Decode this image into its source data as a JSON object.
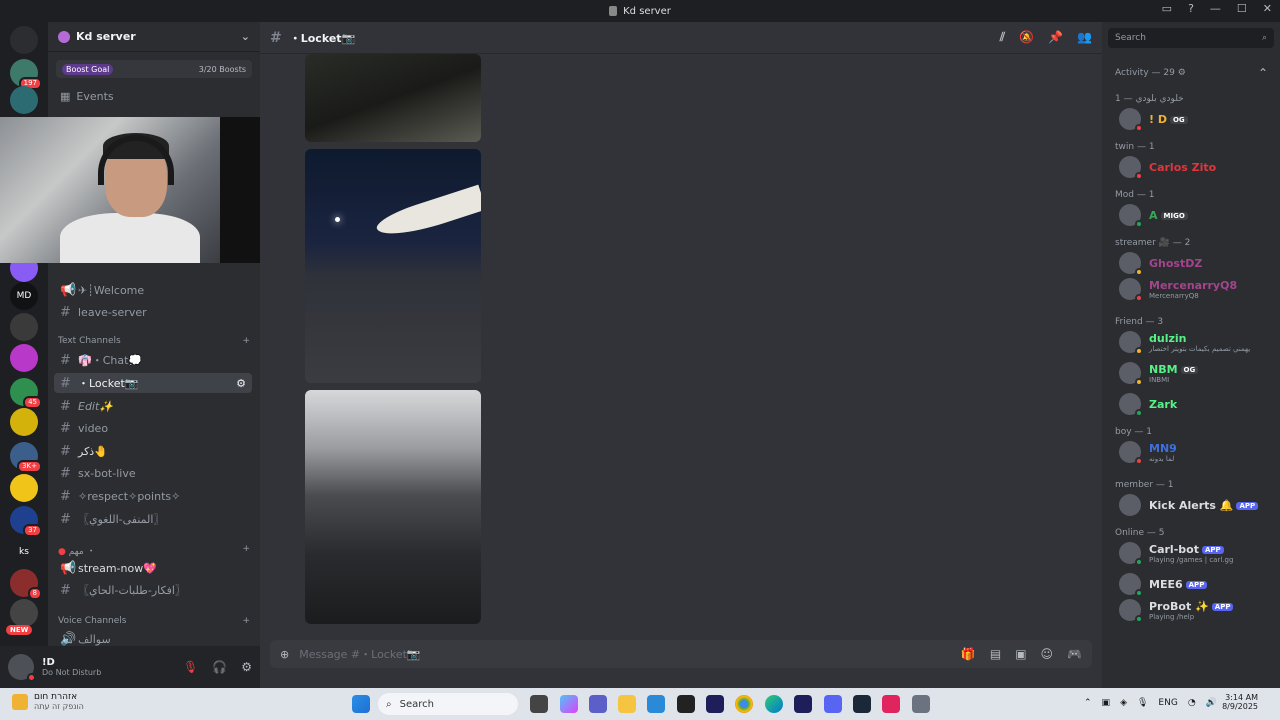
{
  "window": {
    "title": "Kd server"
  },
  "guilds": [
    {
      "label": "",
      "badge": "",
      "color": "#2b2d31"
    },
    {
      "label": "",
      "badge": "197",
      "color": "#3d7a6a"
    },
    {
      "label": "",
      "badge": "",
      "color": "#2d6b73"
    },
    {
      "label": "",
      "badge": "",
      "color": "#8a5cf6"
    },
    {
      "label": "MD",
      "badge": "",
      "color": "#111214"
    },
    {
      "label": "",
      "badge": "",
      "color": "#3a3a3a"
    },
    {
      "label": "",
      "badge": "",
      "color": "#b838c9"
    },
    {
      "label": "",
      "badge": "45",
      "color": "#2f8f4e"
    },
    {
      "label": "",
      "badge": "",
      "color": "#d4b20c"
    },
    {
      "label": "",
      "badge": "3K+",
      "color": "#3b5f8a"
    },
    {
      "label": "",
      "badge": "",
      "color": "#f0c419"
    },
    {
      "label": "",
      "badge": "37",
      "color": "#1f3f8f"
    },
    {
      "label": "ks",
      "badge": "",
      "color": "#1e1f22"
    },
    {
      "label": "",
      "badge": "8",
      "color": "#8c2d2d"
    },
    {
      "label": "",
      "badge": "",
      "color": "#444"
    }
  ],
  "new_badge": "NEW",
  "server": {
    "name": "Kd server",
    "boost_label": "Boost Goal",
    "boost_count": "3/20 Boosts",
    "events_label": "Events"
  },
  "channels": {
    "voice_top": [
      {
        "name": "✈┊Welcome",
        "icon": "📢"
      },
      {
        "name": "leave-server",
        "icon": "#"
      }
    ],
    "text_category": "Text Channels",
    "text": [
      {
        "name": "👘・Chat💭",
        "icon": "#"
      },
      {
        "name": "・Locket📷",
        "icon": "#"
      },
      {
        "name": "Edit✨",
        "icon": "#"
      },
      {
        "name": "video",
        "icon": "#"
      },
      {
        "name": "ذكر🤚",
        "icon": "#"
      },
      {
        "name": "sx-bot-live",
        "icon": "#"
      },
      {
        "name": "✧respect✧points✧",
        "icon": "#"
      },
      {
        "name": "〖المنفى-اللغوي〗",
        "icon": "#"
      }
    ],
    "important_category": "مهم ・",
    "important": [
      {
        "name": "stream-now💖",
        "icon": "📢"
      },
      {
        "name": "〖افكار-طلبات-الحاي〗",
        "icon": "#"
      }
    ],
    "voice_category": "Voice Channels",
    "voice": [
      {
        "name": "سوالف",
        "icon": "🔊"
      }
    ]
  },
  "user": {
    "name": "!D",
    "status": "Do Not Disturb"
  },
  "channel_header": {
    "name": "・Locket📷"
  },
  "composer": {
    "placeholder": "Message #・Locket📷"
  },
  "members": {
    "search_placeholder": "Search",
    "activity_header": "Activity — 29",
    "groups": [
      {
        "title": "خلودي بلودي — 1",
        "members": [
          {
            "name": "! D",
            "tag": "OG",
            "color": "#f0b232",
            "sub": "",
            "status": "#f23f43"
          }
        ]
      },
      {
        "title": "twin — 1",
        "members": [
          {
            "name": "Carlos Zito",
            "tag": "",
            "color": "#e0363c",
            "sub": "",
            "status": "#f23f43"
          }
        ]
      },
      {
        "title": "Mod — 1",
        "members": [
          {
            "name": "A",
            "tag": "MIGO",
            "color": "#3ba55c",
            "sub": "",
            "status": "#23a559"
          }
        ]
      },
      {
        "title": "streamer 🎥 — 2",
        "members": [
          {
            "name": "GhostDZ",
            "tag": "",
            "color": "#a3458c",
            "sub": "",
            "status": "#f0b232"
          },
          {
            "name": "MercenarryQ8",
            "tag": "",
            "color": "#a3458c",
            "sub": "MercenarryQ8",
            "status": "#f23f43"
          }
        ]
      },
      {
        "title": "Friend — 3",
        "members": [
          {
            "name": "dulzin",
            "tag": "",
            "color": "#57f287",
            "sub": "يهمني تصميم بكيمات بتويتر اختصار",
            "status": "#f0b232"
          },
          {
            "name": "NBM",
            "tag": "OG",
            "color": "#57f287",
            "sub": "INBMI",
            "status": "#f0b232"
          },
          {
            "name": "Zark",
            "tag": "",
            "color": "#57f287",
            "sub": "",
            "status": "#23a559"
          }
        ]
      },
      {
        "title": "boy — 1",
        "members": [
          {
            "name": "MN9",
            "tag": "",
            "color": "#3e70dd",
            "sub": "لما بدونه",
            "status": "#f23f43"
          }
        ]
      },
      {
        "title": "member — 1",
        "members": [
          {
            "name": "Kick Alerts 🔔",
            "tag": "APP",
            "color": "#dbdee1",
            "sub": "",
            "status": ""
          }
        ]
      },
      {
        "title": "Online — 5",
        "members": [
          {
            "name": "Carl-bot",
            "tag": "APP",
            "color": "#dbdee1",
            "sub": "Playing /games | carl.gg",
            "status": "#23a559"
          },
          {
            "name": "MEE6",
            "tag": "APP",
            "color": "#dbdee1",
            "sub": "",
            "status": "#23a559"
          },
          {
            "name": "ProBot ✨",
            "tag": "APP",
            "color": "#dbdee1",
            "sub": "Playing /help",
            "status": "#23a559"
          }
        ]
      }
    ]
  },
  "taskbar": {
    "notification_title": "אזהרת חום",
    "notification_sub": "הונפק זה עתה",
    "search": "Search",
    "lang": "ENG",
    "time": "3:14 AM",
    "date": "8/9/2025"
  }
}
